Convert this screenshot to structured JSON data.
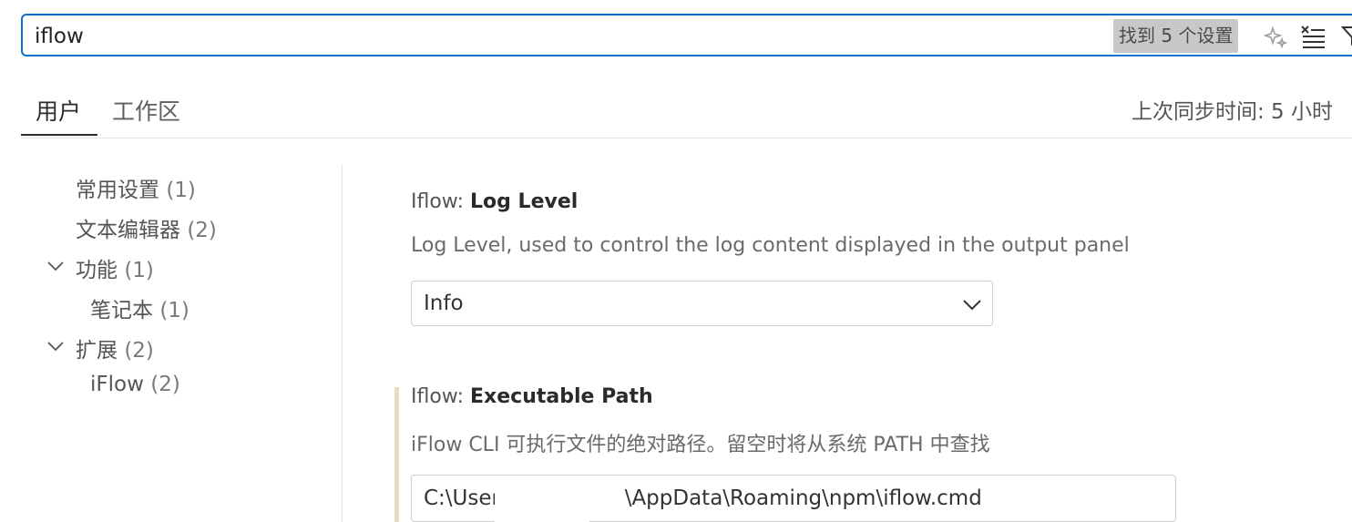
{
  "search": {
    "value": "iflow",
    "result_text": "找到 5 个设置"
  },
  "tabs": {
    "user": "用户",
    "workspace": "工作区"
  },
  "sync_text": "上次同步时间: 5 小时",
  "toc": {
    "items": [
      {
        "label": "常用设置",
        "count": "(1)"
      },
      {
        "label": "文本编辑器",
        "count": "(2)"
      },
      {
        "label": "功能",
        "count": "(1)",
        "expanded": true
      },
      {
        "label": "笔记本",
        "count": "(1)"
      },
      {
        "label": "扩展",
        "count": "(2)",
        "expanded": true
      },
      {
        "label": "iFlow",
        "count": "(2)"
      }
    ]
  },
  "settings": {
    "log_level": {
      "category": "Iflow: ",
      "name": "Log Level",
      "description": "Log Level, used to control the log content displayed in the output panel",
      "value": "Info"
    },
    "exec_path": {
      "category": "Iflow: ",
      "name": "Executable Path",
      "description": "iFlow CLI 可执行文件的绝对路径。留空时将从系统 PATH 中查找",
      "value": "C:\\Users\\                \\AppData\\Roaming\\npm\\iflow.cmd"
    }
  },
  "colors": {
    "accent": "#0f6fcf",
    "modified": "#e8dcc0"
  },
  "icons": [
    "sparkle-icon",
    "clear-filter-icon",
    "filter-icon",
    "chevron-down-icon"
  ]
}
